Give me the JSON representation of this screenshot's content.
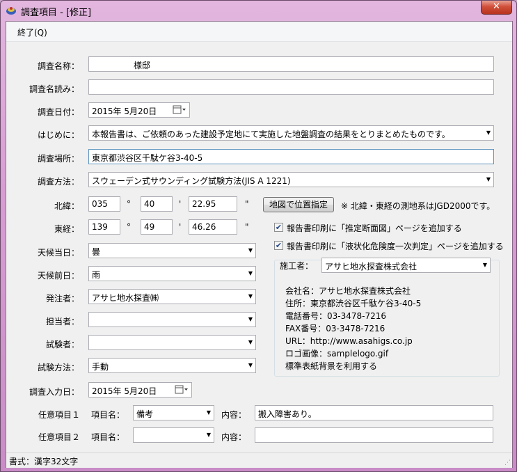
{
  "window": {
    "title": "調査項目 - [修正]",
    "close_label": "✕"
  },
  "menu": {
    "exit_label": "終了(Q)"
  },
  "labels": {
    "survey_name": "調査名称：",
    "survey_reading": "調査名読み：",
    "survey_date": "調査日付：",
    "intro": "はじめに：",
    "location": "調査場所：",
    "method": "調査方法：",
    "latitude": "北緯：",
    "longitude": "東経：",
    "weather_today": "天候当日：",
    "weather_prev": "天候前日：",
    "client": "発注者：",
    "person": "担当者：",
    "tester": "試験者：",
    "test_method": "試験方法：",
    "input_date": "調査入力日：",
    "optional1": "任意項目１",
    "optional2": "任意項目２",
    "item_name": "項目名：",
    "content": "内容："
  },
  "fields": {
    "survey_name": "　　　　　様邸",
    "survey_reading": "",
    "survey_date": "2015年  5月20日",
    "intro": "本報告書は、ご依頼のあった建設予定地にて実施した地盤調査の結果をとりまとめたものです。",
    "location": "東京都渋谷区千駄ケ谷3-40-5",
    "method": "スウェーデン式サウンディング試験方法(JIS A 1221)",
    "lat_deg": "035",
    "lat_min": "40",
    "lat_sec": "22.95",
    "lon_deg": "139",
    "lon_min": "49",
    "lon_sec": "46.26",
    "deg_sym": "°",
    "min_sym": "'",
    "sec_sym": "\"",
    "weather_today": "曇",
    "weather_prev": "雨",
    "client": "アサヒ地水探査㈱",
    "person": "",
    "tester": "",
    "test_method": "手動",
    "input_date": "2015年  5月20日",
    "opt1_name": "備考",
    "opt1_content": "搬入障害あり。",
    "opt2_name": "",
    "opt2_content": ""
  },
  "map_button": "地図で位置指定",
  "datum_note": "※ 北緯・東経の測地系はJGD2000です。",
  "checkboxes": [
    {
      "label": "報告書印刷に「推定断面図」ページを追加する",
      "checked": true
    },
    {
      "label": "報告書印刷に「液状化危険度一次判定」ページを追加する",
      "checked": true
    }
  ],
  "contractor": {
    "label": "施工者：",
    "value": "アサヒ地水探査株式会社",
    "details": [
      "会社名：アサヒ地水探査株式会社",
      "住所：東京都渋谷区千駄ケ谷3-40-5",
      "電話番号：03-3478-7216",
      "FAX番号：03-3478-7216",
      "URL：http://www.asahigs.co.jp",
      "ロゴ画像：samplelogo.gif",
      "標準表紙背景を利用する"
    ]
  },
  "status": {
    "text": "書式：漢字32文字"
  },
  "icons": {
    "calendar": "calendar-icon",
    "dropdown": "chevron-down-icon",
    "check": "check-icon",
    "app": "app-icon"
  }
}
